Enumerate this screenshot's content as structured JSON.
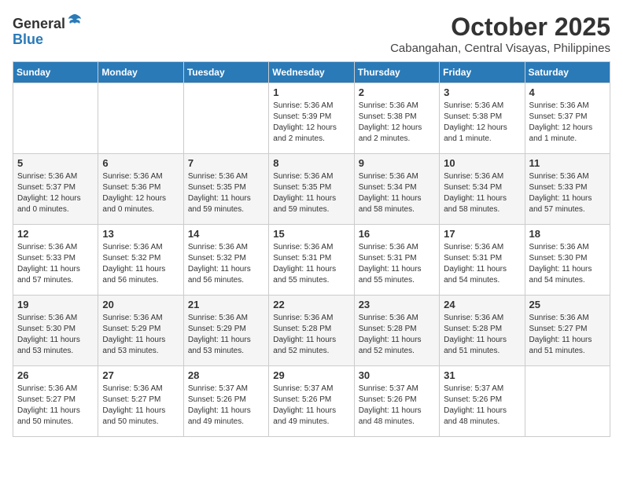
{
  "header": {
    "logo_line1": "General",
    "logo_line2": "Blue",
    "month": "October 2025",
    "location": "Cabangahan, Central Visayas, Philippines"
  },
  "days_of_week": [
    "Sunday",
    "Monday",
    "Tuesday",
    "Wednesday",
    "Thursday",
    "Friday",
    "Saturday"
  ],
  "weeks": [
    [
      {
        "day": null
      },
      {
        "day": null
      },
      {
        "day": null
      },
      {
        "day": "1",
        "sunrise": "5:36 AM",
        "sunset": "5:39 PM",
        "daylight": "12 hours and 2 minutes."
      },
      {
        "day": "2",
        "sunrise": "5:36 AM",
        "sunset": "5:38 PM",
        "daylight": "12 hours and 2 minutes."
      },
      {
        "day": "3",
        "sunrise": "5:36 AM",
        "sunset": "5:38 PM",
        "daylight": "12 hours and 1 minute."
      },
      {
        "day": "4",
        "sunrise": "5:36 AM",
        "sunset": "5:37 PM",
        "daylight": "12 hours and 1 minute."
      }
    ],
    [
      {
        "day": "5",
        "sunrise": "5:36 AM",
        "sunset": "5:37 PM",
        "daylight": "12 hours and 0 minutes."
      },
      {
        "day": "6",
        "sunrise": "5:36 AM",
        "sunset": "5:36 PM",
        "daylight": "12 hours and 0 minutes."
      },
      {
        "day": "7",
        "sunrise": "5:36 AM",
        "sunset": "5:35 PM",
        "daylight": "11 hours and 59 minutes."
      },
      {
        "day": "8",
        "sunrise": "5:36 AM",
        "sunset": "5:35 PM",
        "daylight": "11 hours and 59 minutes."
      },
      {
        "day": "9",
        "sunrise": "5:36 AM",
        "sunset": "5:34 PM",
        "daylight": "11 hours and 58 minutes."
      },
      {
        "day": "10",
        "sunrise": "5:36 AM",
        "sunset": "5:34 PM",
        "daylight": "11 hours and 58 minutes."
      },
      {
        "day": "11",
        "sunrise": "5:36 AM",
        "sunset": "5:33 PM",
        "daylight": "11 hours and 57 minutes."
      }
    ],
    [
      {
        "day": "12",
        "sunrise": "5:36 AM",
        "sunset": "5:33 PM",
        "daylight": "11 hours and 57 minutes."
      },
      {
        "day": "13",
        "sunrise": "5:36 AM",
        "sunset": "5:32 PM",
        "daylight": "11 hours and 56 minutes."
      },
      {
        "day": "14",
        "sunrise": "5:36 AM",
        "sunset": "5:32 PM",
        "daylight": "11 hours and 56 minutes."
      },
      {
        "day": "15",
        "sunrise": "5:36 AM",
        "sunset": "5:31 PM",
        "daylight": "11 hours and 55 minutes."
      },
      {
        "day": "16",
        "sunrise": "5:36 AM",
        "sunset": "5:31 PM",
        "daylight": "11 hours and 55 minutes."
      },
      {
        "day": "17",
        "sunrise": "5:36 AM",
        "sunset": "5:31 PM",
        "daylight": "11 hours and 54 minutes."
      },
      {
        "day": "18",
        "sunrise": "5:36 AM",
        "sunset": "5:30 PM",
        "daylight": "11 hours and 54 minutes."
      }
    ],
    [
      {
        "day": "19",
        "sunrise": "5:36 AM",
        "sunset": "5:30 PM",
        "daylight": "11 hours and 53 minutes."
      },
      {
        "day": "20",
        "sunrise": "5:36 AM",
        "sunset": "5:29 PM",
        "daylight": "11 hours and 53 minutes."
      },
      {
        "day": "21",
        "sunrise": "5:36 AM",
        "sunset": "5:29 PM",
        "daylight": "11 hours and 53 minutes."
      },
      {
        "day": "22",
        "sunrise": "5:36 AM",
        "sunset": "5:28 PM",
        "daylight": "11 hours and 52 minutes."
      },
      {
        "day": "23",
        "sunrise": "5:36 AM",
        "sunset": "5:28 PM",
        "daylight": "11 hours and 52 minutes."
      },
      {
        "day": "24",
        "sunrise": "5:36 AM",
        "sunset": "5:28 PM",
        "daylight": "11 hours and 51 minutes."
      },
      {
        "day": "25",
        "sunrise": "5:36 AM",
        "sunset": "5:27 PM",
        "daylight": "11 hours and 51 minutes."
      }
    ],
    [
      {
        "day": "26",
        "sunrise": "5:36 AM",
        "sunset": "5:27 PM",
        "daylight": "11 hours and 50 minutes."
      },
      {
        "day": "27",
        "sunrise": "5:36 AM",
        "sunset": "5:27 PM",
        "daylight": "11 hours and 50 minutes."
      },
      {
        "day": "28",
        "sunrise": "5:37 AM",
        "sunset": "5:26 PM",
        "daylight": "11 hours and 49 minutes."
      },
      {
        "day": "29",
        "sunrise": "5:37 AM",
        "sunset": "5:26 PM",
        "daylight": "11 hours and 49 minutes."
      },
      {
        "day": "30",
        "sunrise": "5:37 AM",
        "sunset": "5:26 PM",
        "daylight": "11 hours and 48 minutes."
      },
      {
        "day": "31",
        "sunrise": "5:37 AM",
        "sunset": "5:26 PM",
        "daylight": "11 hours and 48 minutes."
      },
      {
        "day": null
      }
    ]
  ],
  "labels": {
    "sunrise_prefix": "Sunrise: ",
    "sunset_prefix": "Sunset: ",
    "daylight_prefix": "Daylight: "
  }
}
